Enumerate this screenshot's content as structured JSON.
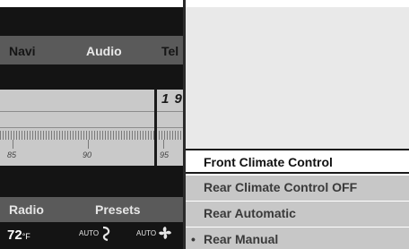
{
  "radio": {
    "menu": {
      "navi": "Navi",
      "audio": "Audio",
      "tel": "Tel"
    },
    "frequency_digits": "1 9",
    "scale": [
      "85",
      "90",
      "95"
    ],
    "soft_keys": {
      "radio": "Radio",
      "presets": "Presets"
    },
    "status": {
      "temperature": "72",
      "unit": "°F",
      "auto_left": "AUTO",
      "auto_right": "AUTO"
    }
  },
  "climate_menu": {
    "items": [
      {
        "label": "Front Climate Control",
        "bullet": ""
      },
      {
        "label": "Rear Climate Control OFF",
        "bullet": ""
      },
      {
        "label": "Rear Automatic",
        "bullet": ""
      },
      {
        "label": "Rear Manual",
        "bullet": "•"
      }
    ],
    "selected_index": 0
  },
  "icons": [
    "air-vent-icon",
    "fan-icon"
  ]
}
